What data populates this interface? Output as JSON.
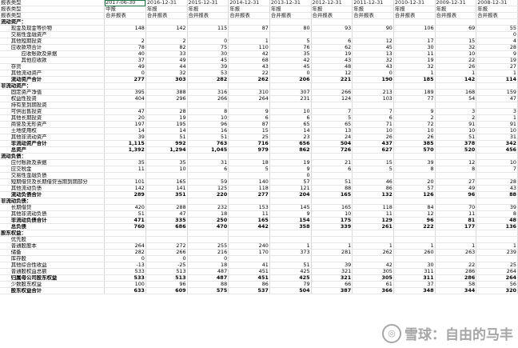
{
  "header_rows": [
    {
      "label": "报表类型",
      "cells": [
        "2017-06-30",
        "2016-12-31",
        "2015-12-31",
        "2014-12-31",
        "2013-12-31",
        "2012-12-31",
        "2011-12-31",
        "2010-12-31",
        "2009-12-31",
        "2008-12-31"
      ]
    },
    {
      "label": "报表类型",
      "cells": [
        "中报",
        "年报",
        "年报",
        "年报",
        "年报",
        "年报",
        "年报",
        "年报",
        "年报",
        "年报"
      ]
    },
    {
      "label": "报表类型",
      "cells": [
        "合并报表",
        "合并报表",
        "合并报表",
        "合并报表",
        "合并报表",
        "合并报表",
        "合并报表",
        "合并报表",
        "合并报表",
        "合并报表"
      ]
    }
  ],
  "rows": [
    {
      "label": "流动资产：",
      "style": "sec",
      "cells": [
        "",
        "",
        "",
        "",
        "",
        "",
        "",
        "",
        "",
        ""
      ]
    },
    {
      "label": "　　现金及现金等价物",
      "cells": [
        "148",
        "142",
        "115",
        "87",
        "80",
        "93",
        "90",
        "106",
        "69",
        "55"
      ]
    },
    {
      "label": "　　交易性金融资产",
      "cells": [
        "",
        "",
        "",
        "",
        "",
        "",
        "",
        "",
        "",
        "0"
      ]
    },
    {
      "label": "　　其他短期投资",
      "cells": [
        "2",
        "2",
        "0",
        "1",
        "5",
        "6",
        "12",
        "17",
        "15",
        "4"
      ]
    },
    {
      "label": "　　应收款项合计",
      "cells": [
        "78",
        "82",
        "75",
        "110",
        "76",
        "62",
        "45",
        "30",
        "32",
        "28"
      ]
    },
    {
      "label": "　　　　应收账款及票据",
      "cells": [
        "40",
        "33",
        "30",
        "42",
        "35",
        "19",
        "13",
        "11",
        "10",
        "9"
      ]
    },
    {
      "label": "　　　　其他应收款",
      "cells": [
        "37",
        "49",
        "45",
        "68",
        "42",
        "43",
        "32",
        "19",
        "22",
        "19"
      ]
    },
    {
      "label": "　　存货",
      "cells": [
        "49",
        "44",
        "39",
        "43",
        "45",
        "48",
        "43",
        "32",
        "26",
        "27"
      ]
    },
    {
      "label": "　　其他流动资产",
      "cells": [
        "0",
        "32",
        "53",
        "22",
        "0",
        "12",
        "0",
        "1",
        "1",
        "1"
      ]
    },
    {
      "label": "　　流动资产合计",
      "style": "bold",
      "cells": [
        "277",
        "303",
        "282",
        "262",
        "206",
        "221",
        "190",
        "185",
        "142",
        "114"
      ]
    },
    {
      "label": "非流动资产：",
      "style": "sec",
      "cells": [
        "",
        "",
        "",
        "",
        "",
        "",
        "",
        "",
        "",
        ""
      ]
    },
    {
      "label": "　　固定资产净值",
      "cells": [
        "395",
        "388",
        "316",
        "310",
        "307",
        "266",
        "213",
        "189",
        "168",
        "159"
      ]
    },
    {
      "label": "　　权益性投资",
      "cells": [
        "404",
        "296",
        "266",
        "264",
        "231",
        "124",
        "103",
        "77",
        "54",
        "47"
      ]
    },
    {
      "label": "　　持有至到期投资",
      "cells": [
        "",
        "",
        "",
        "",
        "",
        "",
        "",
        "",
        "",
        ""
      ]
    },
    {
      "label": "　　可供出售投资",
      "cells": [
        "47",
        "28",
        "8",
        "9",
        "10",
        "7",
        "7",
        "9",
        "3",
        "3"
      ]
    },
    {
      "label": "　　其他长期投资",
      "cells": [
        "20",
        "19",
        "10",
        "6",
        "6",
        "5",
        "6",
        "2",
        "2",
        "1"
      ]
    },
    {
      "label": "　　商誉及无形资产",
      "cells": [
        "197",
        "195",
        "96",
        "87",
        "65",
        "65",
        "71",
        "72",
        "91",
        "91"
      ]
    },
    {
      "label": "　　土地使用权",
      "cells": [
        "14",
        "14",
        "16",
        "15",
        "14",
        "13",
        "10",
        "10",
        "10",
        "10"
      ]
    },
    {
      "label": "　　其他非流动资产",
      "cells": [
        "39",
        "51",
        "51",
        "25",
        "23",
        "24",
        "26",
        "26",
        "51",
        "31"
      ]
    },
    {
      "label": "　　非流动资产合计",
      "style": "bold",
      "cells": [
        "1,115",
        "992",
        "763",
        "716",
        "656",
        "504",
        "437",
        "385",
        "378",
        "342"
      ]
    },
    {
      "label": "　　总资产",
      "style": "bold",
      "cells": [
        "1,392",
        "1,294",
        "1,045",
        "979",
        "862",
        "726",
        "627",
        "570",
        "520",
        "456"
      ]
    },
    {
      "label": "流动负债：",
      "style": "sec",
      "cells": [
        "",
        "",
        "",
        "",
        "",
        "",
        "",
        "",
        "",
        ""
      ]
    },
    {
      "label": "　　应付账款及票据",
      "cells": [
        "35",
        "35",
        "31",
        "18",
        "19",
        "21",
        "15",
        "39",
        "12",
        "10"
      ]
    },
    {
      "label": "　　应交税金",
      "cells": [
        "11",
        "10",
        "6",
        "5",
        "9",
        "6",
        "5",
        "8",
        "8",
        "7"
      ]
    },
    {
      "label": "　　交易性金融负债",
      "cells": [
        "",
        "",
        "",
        "",
        "0",
        "",
        "",
        "",
        "",
        ""
      ]
    },
    {
      "label": "　　短期借贷及长期借贷当期到期部分",
      "cells": [
        "101",
        "165",
        "59",
        "140",
        "57",
        "51",
        "46",
        "20",
        "27",
        "28"
      ]
    },
    {
      "label": "　　其他流动负债",
      "cells": [
        "142",
        "141",
        "125",
        "118",
        "121",
        "88",
        "86",
        "57",
        "49",
        "43"
      ]
    },
    {
      "label": "　　流动负债合计",
      "style": "bold",
      "cells": [
        "289",
        "351",
        "220",
        "277",
        "204",
        "165",
        "132",
        "126",
        "96",
        "88"
      ]
    },
    {
      "label": "非流动负债：",
      "style": "sec",
      "cells": [
        "",
        "",
        "",
        "",
        "",
        "",
        "",
        "",
        "",
        ""
      ]
    },
    {
      "label": "　　长期借贷",
      "cells": [
        "420",
        "288",
        "232",
        "153",
        "145",
        "165",
        "118",
        "84",
        "70",
        "39"
      ]
    },
    {
      "label": "　　其他非流动负债",
      "cells": [
        "51",
        "47",
        "18",
        "11",
        "9",
        "10",
        "11",
        "12",
        "11",
        "8"
      ]
    },
    {
      "label": "　　非流动负债合计",
      "style": "bold",
      "cells": [
        "471",
        "335",
        "250",
        "165",
        "154",
        "175",
        "129",
        "96",
        "81",
        "48"
      ]
    },
    {
      "label": "　　总负债",
      "style": "bold",
      "cells": [
        "760",
        "686",
        "470",
        "442",
        "358",
        "339",
        "261",
        "222",
        "177",
        "136"
      ]
    },
    {
      "label": "股东权益：",
      "style": "sec",
      "cells": [
        "",
        "",
        "",
        "",
        "",
        "",
        "",
        "",
        "",
        ""
      ]
    },
    {
      "label": "　　优先股",
      "cells": [
        "",
        "",
        "",
        "",
        "",
        "",
        "",
        "",
        "",
        ""
      ]
    },
    {
      "label": "　　普通股股本",
      "cells": [
        "264",
        "272",
        "255",
        "240",
        "1",
        "1",
        "1",
        "1",
        "1",
        "1"
      ]
    },
    {
      "label": "　　储备",
      "cells": [
        "282",
        "266",
        "216",
        "170",
        "373",
        "281",
        "262",
        "260",
        "263",
        "239"
      ]
    },
    {
      "label": "　　库存股",
      "cells": [
        "0",
        "0",
        "0",
        "",
        "",
        "",
        "",
        "",
        "",
        ""
      ]
    },
    {
      "label": "　　其他综合性收益",
      "cells": [
        "-13",
        "-25",
        "18",
        "41",
        "51",
        "39",
        "42",
        "30",
        "22",
        "25"
      ]
    },
    {
      "label": "　　普通股权益总额",
      "cells": [
        "533",
        "513",
        "487",
        "451",
        "425",
        "321",
        "305",
        "311",
        "286",
        "264"
      ]
    },
    {
      "label": "　　归属母公司股东权益",
      "style": "bold",
      "cells": [
        "533",
        "513",
        "487",
        "451",
        "425",
        "321",
        "305",
        "311",
        "286",
        "264"
      ]
    },
    {
      "label": "　　少数股东权益",
      "cells": [
        "100",
        "96",
        "88",
        "86",
        "79",
        "66",
        "61",
        "37",
        "58",
        "56"
      ]
    },
    {
      "label": "　　股东权益合计",
      "style": "bold",
      "cells": [
        "633",
        "609",
        "575",
        "537",
        "504",
        "387",
        "366",
        "348",
        "344",
        "320"
      ]
    }
  ],
  "watermark": {
    "logo_glyph": "◎",
    "text": "雪球：自由的马丰"
  }
}
